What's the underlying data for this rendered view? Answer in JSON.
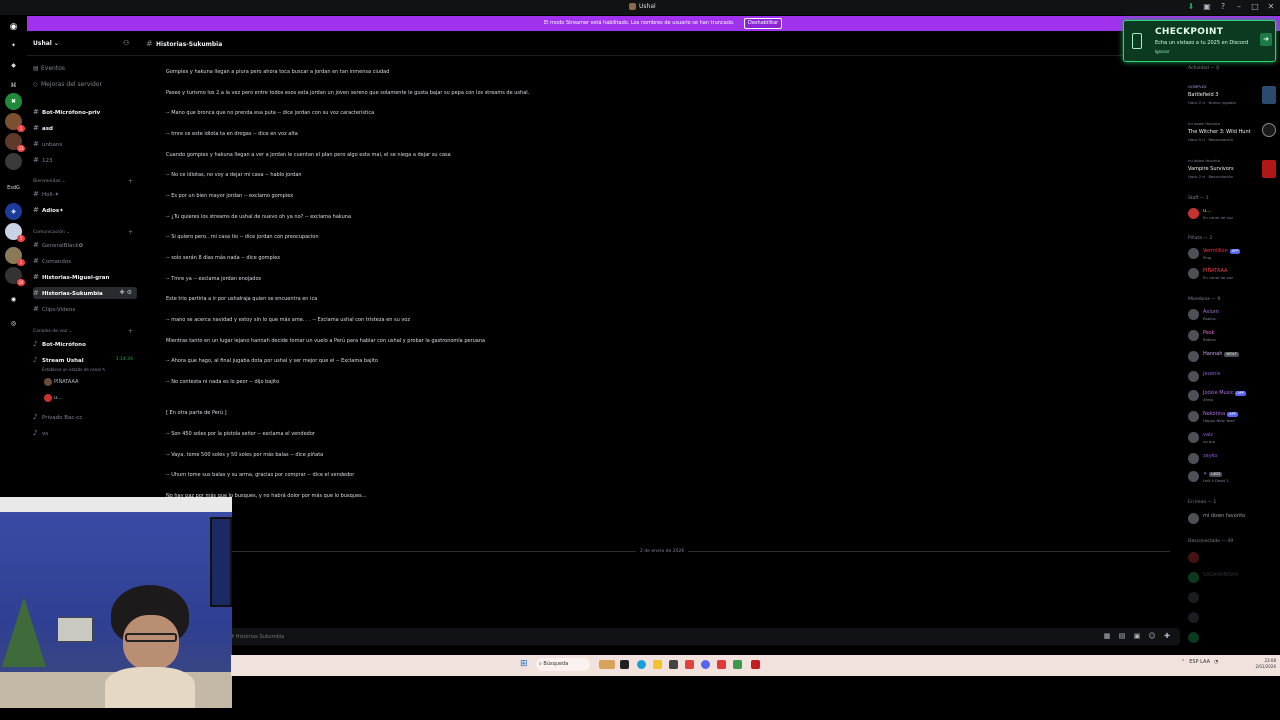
{
  "window": {
    "title": "Ushal"
  },
  "banner": {
    "text": "El modo Streamer está habilitado. Los nombres de usuario se han truncado.",
    "button": "Deshabilitar"
  },
  "rail": {
    "items": [
      {
        "label": "",
        "badge": ""
      },
      {
        "label": "",
        "badge": ""
      },
      {
        "label": "",
        "badge": ""
      },
      {
        "label": "",
        "badge": ""
      },
      {
        "label": "",
        "badge": ""
      },
      {
        "label": "",
        "badge": ""
      },
      {
        "label": "EsdG",
        "badge": ""
      },
      {
        "label": "",
        "badge": ""
      },
      {
        "label": "",
        "badge": ""
      },
      {
        "label": "",
        "badge": ""
      },
      {
        "label": "",
        "badge": ""
      },
      {
        "label": "",
        "badge": ""
      },
      {
        "label": "",
        "badge": ""
      }
    ]
  },
  "sidebar": {
    "server_name": "Ushal ⌄",
    "top_items": [
      "Eventos",
      "Mejoras del servidor"
    ],
    "channels_group1": [
      "Bot-Micrófono-priv",
      "asd",
      "unbans",
      "123"
    ],
    "cat_bienvenidas": "Bienvenidas ⌄",
    "bienvenidas": [
      "Holi-✦",
      "Adios✦"
    ],
    "cat_comunicacion": "Comunicación ⌄",
    "comunicacion": [
      "GeneralBlack✿",
      "Comandos",
      "Historias-Miguel-gran",
      "Historias-Sukumbia",
      "Clips-Videos"
    ],
    "cat_voz": "Canales de voz ⌄",
    "voz": [
      "Bot-Micrófono",
      "Stream Ushal"
    ],
    "stream_time": "3:14:34",
    "stream_status": "Establece un estado de canal ✎",
    "voice_users": [
      "PIÑATAAA",
      "u..."
    ],
    "voz_more": [
      "Privado Bac-cc",
      "vs"
    ]
  },
  "channel": {
    "title": "Historias-Sukumbia"
  },
  "messages": [
    "Gompiex y hakuna llegan a piura pero ahora toca buscar a jordan en tan inmensa ciudad",
    "Paseo y turismo los 2 a la vez pero entre todos esos esta jordan un joven sereno que solamente le gusta bajar su pepa con los streams de ushal.",
    "-- Mano que bronca que no prenda esa puta -- dice jordan con su voz característica",
    "-- tmre ce este idiota ta en drogas -- dice en voz alta",
    "Cuando gompiex y hakuna llegan a ver a jordan le cuentan el plan pero algo esta mal, el se niega a dejar su casa",
    "-- No ce idiotas, no voy a dejar mi casa -- hablo jordan",
    "-- Es por un bien mayor jordan -- exclamo gompiex",
    "-- ¿Tu quieres los streams de ushal de nuevo oh ya no? -- exclama hakuna",
    "-- Si quiero pero.. mi casa tio -- dice jordan con preocupacion",
    "-- solo serán 8 dias más nada -- dice gompiex",
    "-- Tmre ya -- exclama jordan enojados",
    "Este trio partiria a ir por ushalraja quien se encuentra en ica",
    "-- mano se acerca navidad y estoy sin lo que más ame. . . -- Exclama ushal con tristeza en su voz",
    "Mientras tanto en un lugar lejano hannah decide tomar un vuelo a Perú para hablar con ushal y probar la gastronomía peruana",
    "-- Ahora que hago, al final jugaba dota por ushal y ser mejor que el -- Exclama bajito",
    "-- No contesta ni nada es lo peor -- dijo bajito",
    "[ En otra parte de Perú ]",
    "-- Son 450 soles por la pistola señor -- exclama el vendedor",
    "-- Vaya, tome 500 soles y 50 soles por más balas -- dice piñata",
    "-- Uhum tome sus balas y su arma, gracias por comprar -- dice el vendedor",
    "No hay paz por más que lo busques, y no habrá dolor por más que lo busques..."
  ],
  "date_divider": "2 de enero de 2026",
  "composer": {
    "placeholder": "# Historias-Sukumbia"
  },
  "checkpoint": {
    "title": "CHECKPOINT",
    "subtitle": "Echa un vistazo a tu 2025 en Discord",
    "link": "Ignorar"
  },
  "members": {
    "activity_header": "Actividad — 0",
    "activities": [
      {
        "pre": "GOMPLEX",
        "game": "Battlefield 3",
        "meta": "Hace 2 d · Nuevo jugador",
        "color": "#2b4a6e"
      },
      {
        "pre": "mi down favorito",
        "game": "The Witcher 3: Wild Hunt",
        "meta": "Hace 5 h · Reanudación",
        "color": "#1a1a1a"
      },
      {
        "pre": "mi down favorito",
        "game": "Vampire Survivors",
        "meta": "Hace 2 d · Reanudación",
        "color": "#b01818"
      }
    ],
    "staff_header": "Staff — 1",
    "staff": [
      {
        "name": "u...",
        "status": "En canal de voz",
        "color": "#f2c94c"
      }
    ],
    "pinata_header": "Piñata — 2",
    "pinata": [
      {
        "name": "Vermillion",
        "status": "Ping",
        "tag": "APP",
        "color": "#f23f43"
      },
      {
        "name": "PIÑATAAA",
        "status": "En canal de voz",
        "tag": "",
        "color": "#f23f43"
      }
    ],
    "miembros_header": "Miembros — 9",
    "miembros": [
      {
        "name": "Axium",
        "status": "Roblox",
        "tag": "",
        "color": "#b56fe8"
      },
      {
        "name": "Pesk",
        "status": "Roblox",
        "tag": "",
        "color": "#e06fd1"
      },
      {
        "name": "Hannah",
        "status": "",
        "tag": "WOLF",
        "color": "#c9a7f0"
      },
      {
        "name": "jesenis",
        "status": "",
        "tag": "",
        "color": "#8e5bd8"
      },
      {
        "name": "Jockie Music",
        "status": "/Help",
        "tag": "APP",
        "color": "#b56fe8"
      },
      {
        "name": "Nekotina",
        "status": "Happy New Year!",
        "tag": "APP",
        "color": "#b56fe8"
      },
      {
        "name": "valz",
        "status": "no bro",
        "tag": "",
        "color": "#8e5bd8"
      },
      {
        "name": "zayko",
        "status": "",
        "tag": "",
        "color": "#8e5bd8"
      },
      {
        "name": "✦",
        "status": "Left 4 Dead 2",
        "tag": "L4D2",
        "color": "#8e5bd8"
      }
    ],
    "enlinea_header": "En línea — 1",
    "enlinea": [
      {
        "name": "mi down favorito",
        "status": "",
        "color": "#949ba4"
      }
    ],
    "offline_header": "Desconectado — 49",
    "offline": [
      "",
      "SASAHANDAA",
      "",
      "",
      ""
    ]
  },
  "taskbar": {
    "search": "Búsqueda",
    "tray": "ESP LAA",
    "time": "23:08",
    "date": "2/01/2026"
  },
  "colors": {
    "accent": "#a032ee",
    "online": "#23a559",
    "checkpoint": "#2dd36f"
  }
}
